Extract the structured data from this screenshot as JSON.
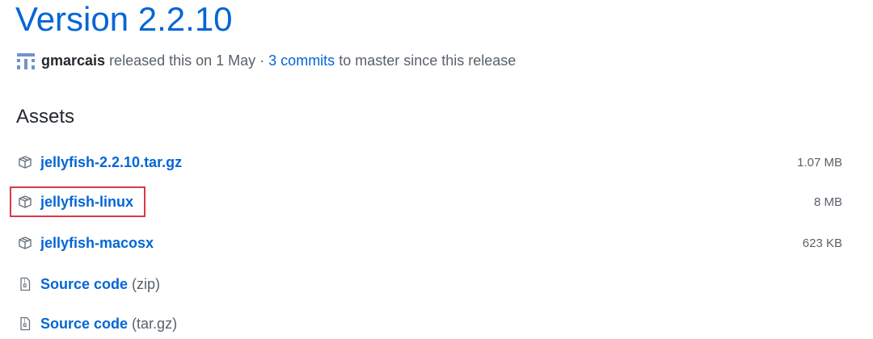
{
  "release": {
    "title": "Version 2.2.10",
    "author": "gmarcais",
    "released_text": " released this on 1 May · ",
    "commits_link": "3 commits",
    "commits_suffix": " to master since this release"
  },
  "assets": {
    "heading": "Assets",
    "items": [
      {
        "name": "jellyfish-2.2.10.tar.gz",
        "suffix": "",
        "size": "1.07 MB",
        "icon": "package-icon"
      },
      {
        "name": "jellyfish-linux",
        "suffix": "",
        "size": "8 MB",
        "icon": "package-icon"
      },
      {
        "name": "jellyfish-macosx",
        "suffix": "",
        "size": "623 KB",
        "icon": "package-icon"
      },
      {
        "name": "Source code",
        "suffix": "(zip)",
        "size": "",
        "icon": "file-zip-icon"
      },
      {
        "name": "Source code",
        "suffix": "(tar.gz)",
        "size": "",
        "icon": "file-zip-icon"
      }
    ]
  },
  "colors": {
    "link": "#0366d6",
    "highlight_border": "#d73a49",
    "muted": "#586069"
  }
}
